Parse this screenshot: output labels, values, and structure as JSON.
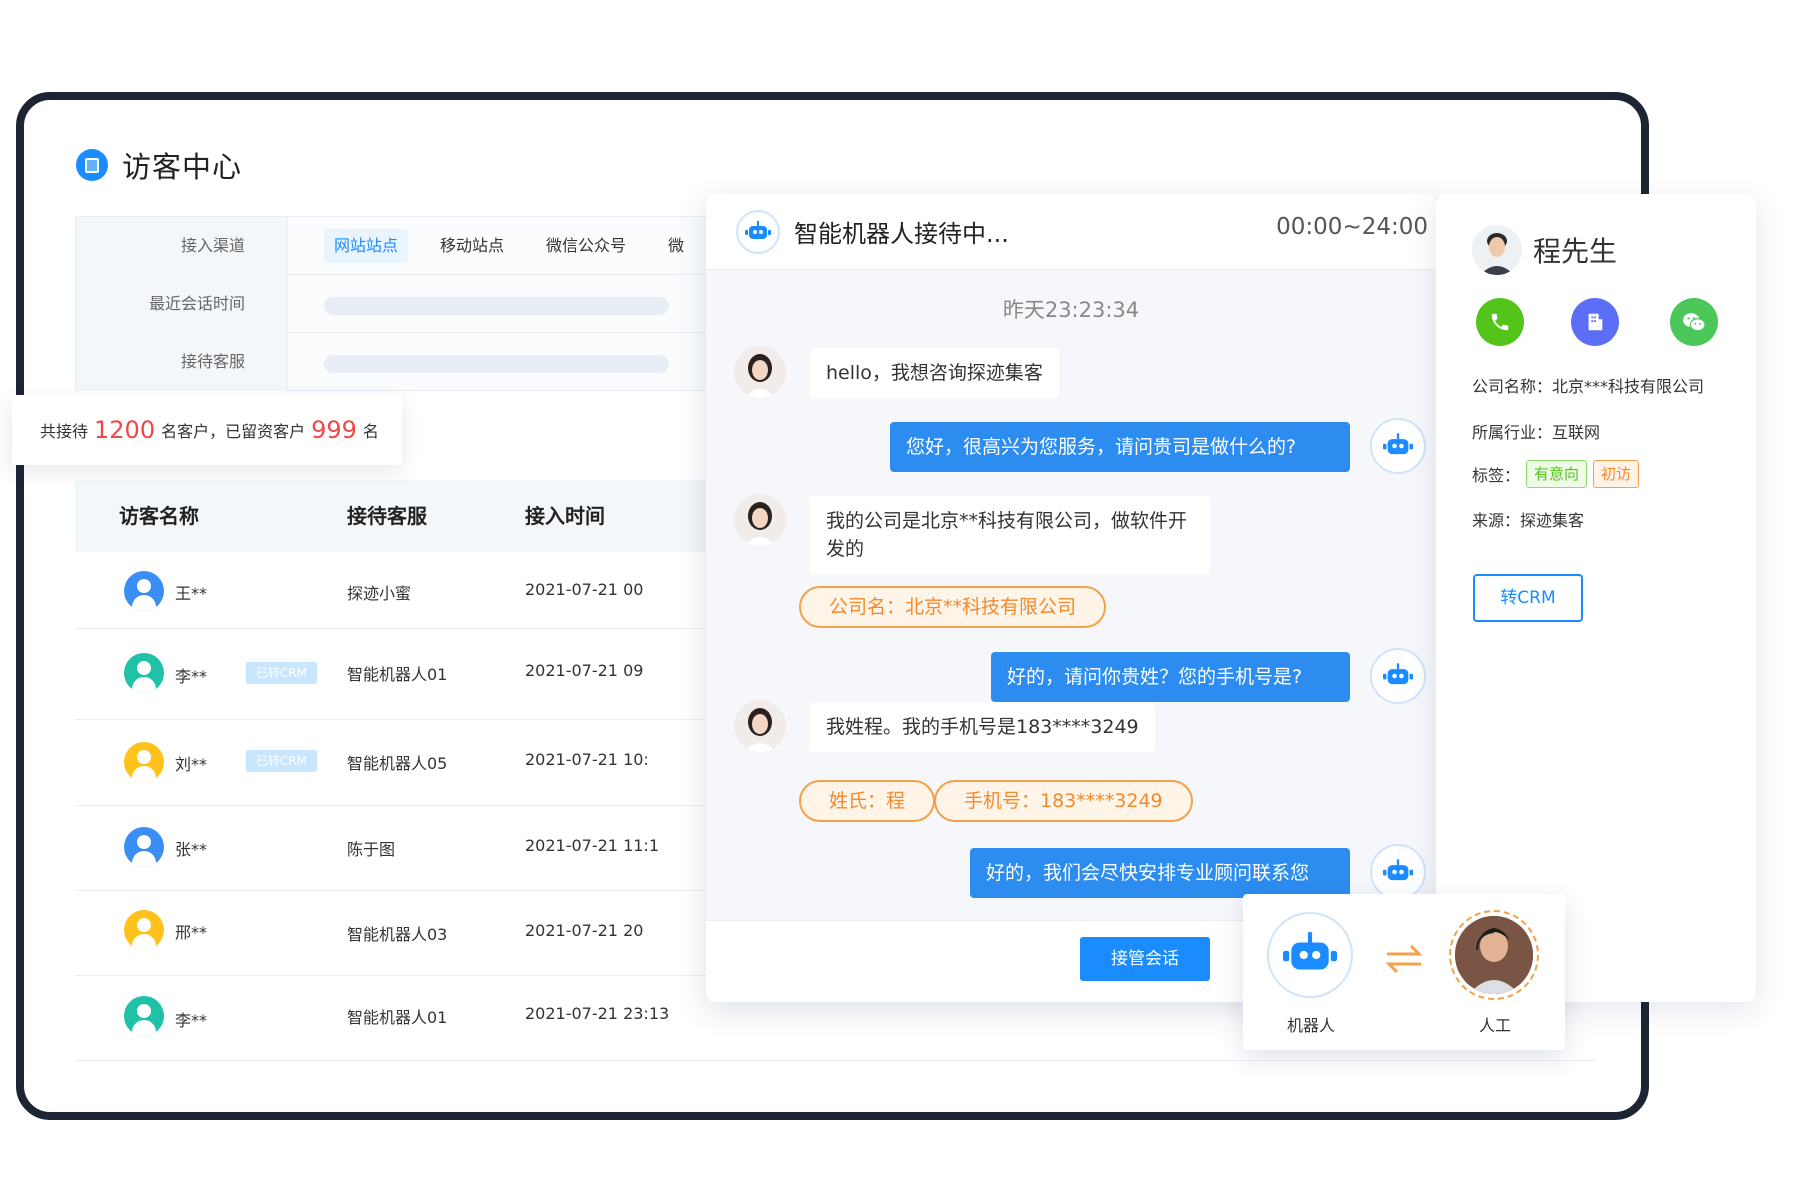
{
  "app": {
    "title": "访客中心"
  },
  "filters": {
    "channel_label": "接入渠道",
    "channels": [
      "网站站点",
      "移动站点",
      "微信公众号",
      "微"
    ],
    "last_session_label": "最近会话时间",
    "agent_label": "接待客服"
  },
  "stats": {
    "prefix": "共接待",
    "total": "1200",
    "middle": "名客户，已留资客户",
    "leads": "999",
    "suffix": "名"
  },
  "table": {
    "headers": [
      "访客名称",
      "接待客服",
      "接入时间"
    ],
    "rows": [
      {
        "name": "王**",
        "agent": "探迹小蜜",
        "time": "2021-07-21 00",
        "crm": "",
        "color": "#3a8ef6"
      },
      {
        "name": "李**",
        "agent": "智能机器人01",
        "time": "2021-07-21 09",
        "crm": "已转CRM",
        "color": "#1fc2a7"
      },
      {
        "name": "刘**",
        "agent": "智能机器人05",
        "time": "2021-07-21 10:",
        "crm": "已转CRM",
        "color": "#ffc21a"
      },
      {
        "name": "张**",
        "agent": "陈于图",
        "time": "2021-07-21 11:1",
        "crm": "",
        "color": "#3a8ef6"
      },
      {
        "name": "邢**",
        "agent": "智能机器人03",
        "time": "2021-07-21 20",
        "crm": "",
        "color": "#ffc21a"
      },
      {
        "name": "李**",
        "agent": "智能机器人01",
        "time": "2021-07-21 23:13",
        "crm": "",
        "color": "#1fc2a7"
      }
    ]
  },
  "chat": {
    "title": "智能机器人接待中...",
    "hours": "00:00~24:00",
    "timestamp": "昨天23:23:34",
    "messages": [
      {
        "side": "left",
        "text": "hello，我想咨询探迹集客"
      },
      {
        "side": "right",
        "text": "您好，很高兴为您服务，请问贵司是做什么的?"
      },
      {
        "side": "left",
        "text": "我的公司是北京**科技有限公司，做软件开发的"
      },
      {
        "side": "right",
        "text": "好的，请问你贵姓？您的手机号是?"
      },
      {
        "side": "left",
        "text": "我姓程。我的手机号是183****3249"
      },
      {
        "side": "right",
        "text": "好的，我们会尽快安排专业顾问联系您"
      }
    ],
    "extracted": [
      "公司名：北京**科技有限公司",
      "姓氏：程",
      "手机号：183****3249"
    ],
    "takeover_label": "接管会话"
  },
  "customer": {
    "name": "程先生",
    "company": "公司名称：北京***科技有限公司",
    "industry": "所属行业：互联网",
    "tags_label": "标签：",
    "tags": [
      "有意向",
      "初访"
    ],
    "source": "来源：探迹集客",
    "crm_button": "转CRM",
    "colors": {
      "phone": "#52c41a",
      "company": "#5b6ef5",
      "wechat": "#4cc75a"
    }
  },
  "switch": {
    "robot_label": "机器人",
    "human_label": "人工"
  }
}
